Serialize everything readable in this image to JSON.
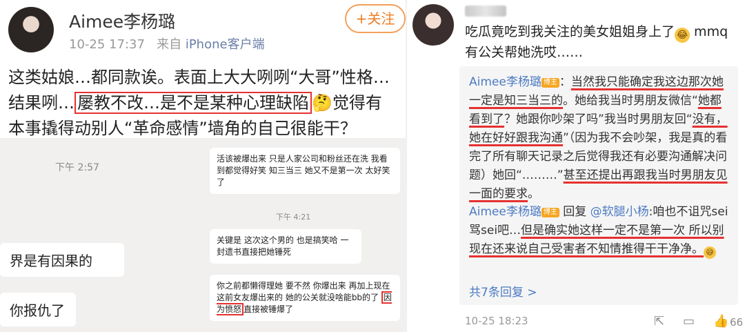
{
  "left": {
    "user_name": "Aimee李杨璐",
    "timestamp": "10-25 17:37",
    "source_prefix": "来自",
    "source": "iPhone客户端",
    "follow_label": "+关注",
    "body_line1": "这类姑娘…都同款诶。表面上大大咧咧“大哥”性格…",
    "body_line2_pre": "结果咧…",
    "body_line2_boxed": "屡教不改…是不是某种心理缺陷",
    "body_line2_post": "🤔觉得有",
    "body_line3": "本事撬得动别人“革命感情”墙角的自己很能干？",
    "chat": {
      "time1": "下午 2:57",
      "time2": "下午 4:21",
      "bubble_left1": "界是有因果的",
      "bubble_left2": "你报仇了",
      "bubble_right1": "活该被爆出来 只是人家公司和粉丝还在洗 我看到都觉得好笑 知三当三 她又不是第一次 太好笑了",
      "bubble_right2": "关键是 这次这个男的 也是搞笑哈 一封遗书直接把她锤死",
      "bubble_right3_pre": "你之前都懒得理她 要不然 你爆出来 再加上现在这前女友爆出来的 她的公关就没啥能bb的了",
      "bubble_right3_boxed": "因为愤怒",
      "bubble_right3_post": "直接被锤爆了"
    }
  },
  "right": {
    "main_text": "吃瓜竟吃到我关注的美女姐姐身上了",
    "main_text_2": " mmq有公关帮她洗哎……",
    "reply1_name": "Aimee李杨璐",
    "reply1_tag": "博主",
    "reply1_a": "：",
    "reply1_u1": "当然我只能确定我这边那次她一定是知三当三的",
    "reply1_b": "。她给我当时男朋友微信“",
    "reply1_u2": "她都看到了",
    "reply1_c": "？她跟你吵架了吗”我当时男朋友回“",
    "reply1_u3": "没有，她在好好跟我沟通",
    "reply1_d": "”（因为我不会吵架，我是真的看完了所有聊天记录之后觉得我还有必要沟通解决问题）她回“………”",
    "reply1_u4": "甚至还提出再跟我当时男朋友见一面的要求",
    "reply1_e": "。",
    "reply2_name": "Aimee李杨璐",
    "reply2_tag": "博主",
    "reply2_a": "回复",
    "reply2_mention": "@软腿小杨",
    "reply2_b": ":咱也不诅咒sei骂sei吧…",
    "reply2_u1": "但是确实她这样一定不是第一次 所以别现在还来说自己受害者不知情推得干干净",
    "reply2_c": "净。",
    "more_replies": "共7条回复 >",
    "timestamp": "10-25 18:23",
    "like_count": "66"
  },
  "icons": [
    "avatar",
    "share-icon",
    "comment-icon",
    "like-icon",
    "emoji-icon"
  ]
}
